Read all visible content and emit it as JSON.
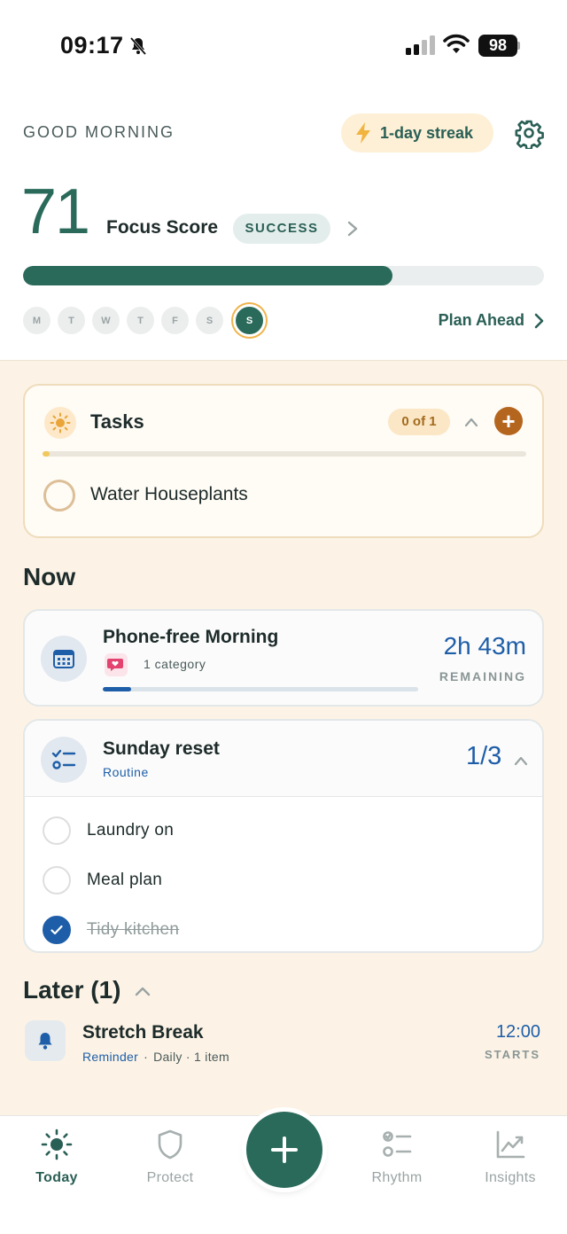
{
  "status_bar": {
    "time": "09:17",
    "battery": "98"
  },
  "header": {
    "greeting": "GOOD MORNING",
    "streak": "1-day streak",
    "score": "71",
    "score_label": "Focus Score",
    "score_badge": "SUCCESS",
    "score_progress": 0.71,
    "days": [
      "M",
      "T",
      "W",
      "T",
      "F",
      "S",
      "S"
    ],
    "active_day_index": 6,
    "plan_ahead": "Plan Ahead"
  },
  "tasks": {
    "title": "Tasks",
    "count": "0 of 1",
    "progress": 0.0,
    "items": [
      {
        "label": "Water Houseplants",
        "done": false
      }
    ]
  },
  "now": {
    "heading": "Now",
    "session": {
      "title": "Phone-free Morning",
      "category": "1 category",
      "time": "2h 43m",
      "remaining": "REMAINING",
      "progress": 0.09
    },
    "routine": {
      "title": "Sunday reset",
      "subtitle": "Routine",
      "count": "1/3",
      "items": [
        {
          "label": "Laundry on",
          "done": false
        },
        {
          "label": "Meal plan",
          "done": false
        },
        {
          "label": "Tidy kitchen",
          "done": true
        }
      ]
    }
  },
  "later": {
    "heading": "Later (1)",
    "reminder": {
      "title": "Stretch Break",
      "type": "Reminder",
      "sep": "·",
      "schedule": "Daily · 1 item",
      "time": "12:00",
      "starts": "STARTS"
    }
  },
  "tabs": [
    {
      "label": "Today",
      "icon": "sun-icon",
      "active": true
    },
    {
      "label": "Protect",
      "icon": "shield-icon",
      "active": false
    },
    {
      "label": "Rhythm",
      "icon": "checklist-icon",
      "active": false
    },
    {
      "label": "Insights",
      "icon": "chart-icon",
      "active": false
    }
  ],
  "colors": {
    "primary": "#2a6a5a",
    "blue": "#1e5ea8",
    "background": "#fcf3e6",
    "task_accent": "#b5661e"
  }
}
